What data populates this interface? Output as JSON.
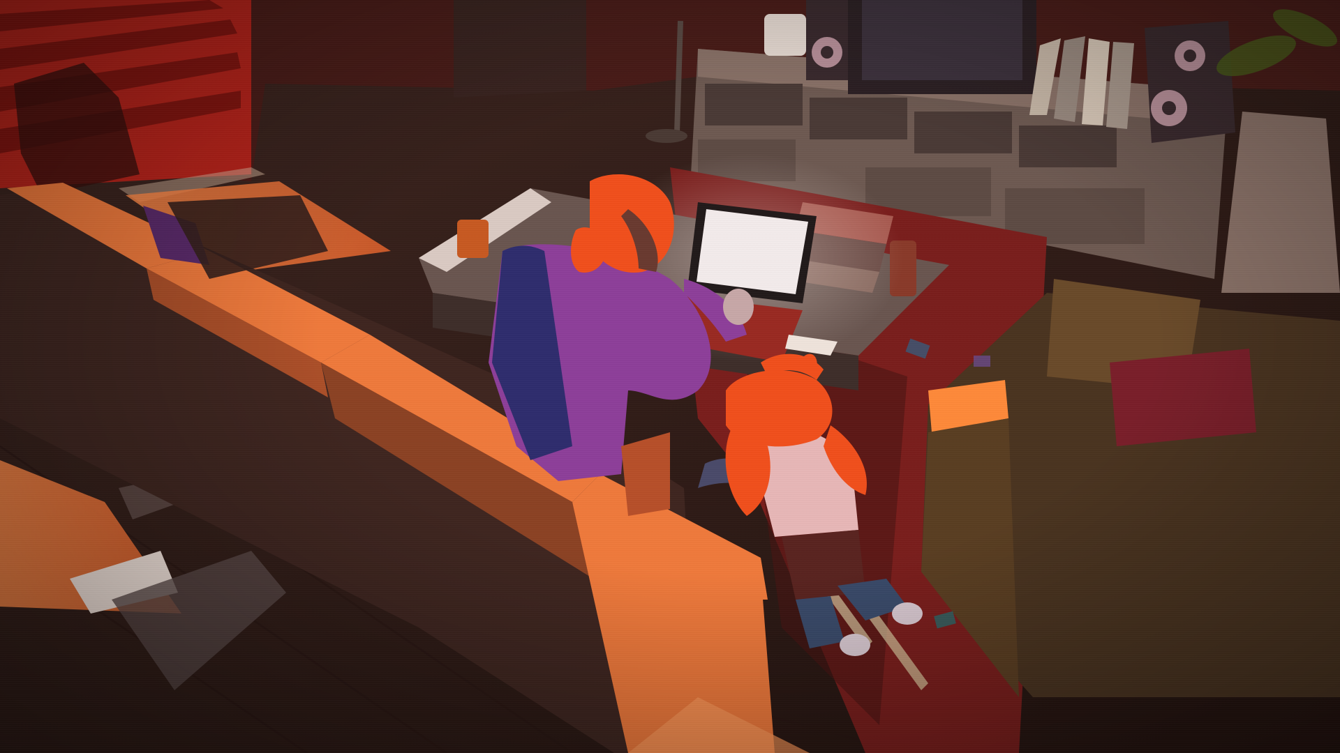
{
  "scene": {
    "type": "game-cutscene",
    "setting": "living-room",
    "hud": null
  },
  "palette": {
    "floor": "#3a221d",
    "floor_dark": "#2a1714",
    "sunlight": "#f07a3c",
    "sunlight_bright": "#ff9a5a",
    "window_red": "#c8281e",
    "sofa_lit": "#f07a3c",
    "sofa_shadow": "#3f2620",
    "armchair": "#5a3e22",
    "armchair_cushion": "#7a1f2a",
    "hair": "#f2501c",
    "shirt": "#8e3f9a",
    "shirt_shadow": "#2f2d6e",
    "laptop_screen": "#f4ecec",
    "rug": "#7a1e1c",
    "tv_cabinet": "#6e5a52",
    "speaker": "#3a2a2e"
  }
}
